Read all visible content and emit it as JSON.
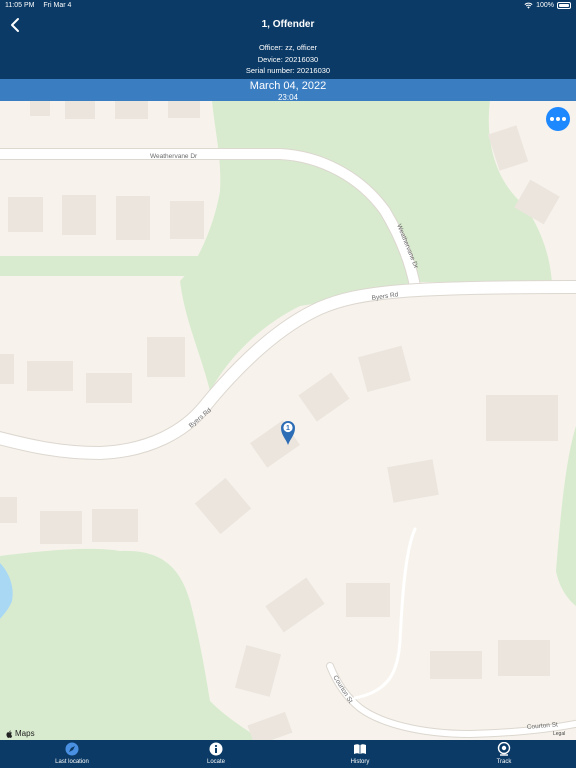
{
  "status_bar": {
    "time": "11:05 PM",
    "date": "Fri Mar 4",
    "battery": "100%"
  },
  "header": {
    "title": "1, Offender",
    "officer": "Officer: zz, officer",
    "device": "Device: 20216030",
    "serial": "Serial number:  20216030"
  },
  "date_bar": {
    "date": "March 04, 2022",
    "time": "23:04"
  },
  "map": {
    "streets": {
      "weathervane_1": "Weathervane Dr",
      "weathervane_2": "Weathervane Dr",
      "byers_1": "Byers Rd",
      "byers_2": "Byers Rd",
      "courton_1": "Courton St",
      "courton_2": "Courton St"
    },
    "marker_label": "1",
    "attribution": "Maps",
    "legal": "Legal",
    "pin_color": "#2d6db5",
    "park_color": "#d8ebcf",
    "water_color": "#a9d8f5"
  },
  "tabs": [
    {
      "label": "Last location",
      "icon": "compass-icon"
    },
    {
      "label": "Locate",
      "icon": "info-icon"
    },
    {
      "label": "History",
      "icon": "book-icon"
    },
    {
      "label": "Track",
      "icon": "track-icon"
    }
  ],
  "colors": {
    "nav": "#0b3a66",
    "date_bar": "#3b7dc1",
    "accent": "#1e88ff"
  }
}
